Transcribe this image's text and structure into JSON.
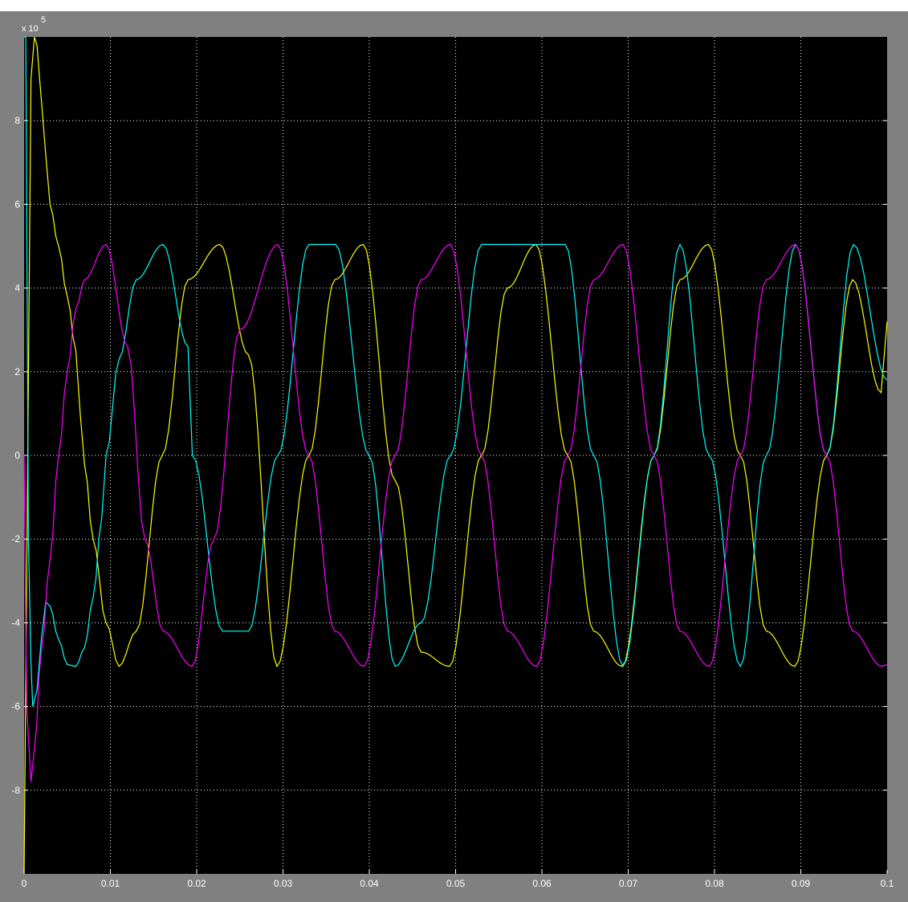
{
  "window": {
    "frame_color": "#808080",
    "plot_background": "#000000",
    "grid_color": "#ffffff",
    "axis_text_color": "#ffffff"
  },
  "chart_data": {
    "type": "line",
    "title": "",
    "xlabel": "",
    "ylabel": "",
    "x_range": [
      0,
      0.1
    ],
    "y_range": [
      -1000000,
      1000000
    ],
    "y_exponent_label": {
      "base": "x 10",
      "exponent": "5"
    },
    "x_ticks": [
      "0",
      "0.01",
      "0.02",
      "0.03",
      "0.04",
      "0.05",
      "0.06",
      "0.07",
      "0.08",
      "0.09",
      "0.1"
    ],
    "x_tick_values": [
      0,
      0.01,
      0.02,
      0.03,
      0.04,
      0.05,
      0.06,
      0.07,
      0.08,
      0.09,
      0.1
    ],
    "y_ticks": [
      "-8",
      "-6",
      "-4",
      "-2",
      "0",
      "2",
      "4",
      "6",
      "8"
    ],
    "y_tick_values": [
      -800000,
      -600000,
      -400000,
      -200000,
      0,
      200000,
      400000,
      600000,
      800000
    ],
    "grid": true,
    "legend": "none",
    "steady_state": {
      "amplitude": 504000,
      "frequency_hz": 50
    },
    "series": [
      {
        "color": "#ffff00",
        "x": [
          0,
          0.0003,
          0.0008,
          0.0012,
          0.0015,
          0.0018,
          0.002,
          0.0025,
          0.003,
          0.004,
          0.005,
          0.006,
          0.0065,
          0.007,
          0.008,
          0.0095,
          0.011,
          0.013,
          0.016,
          0.019,
          0.0227,
          0.026,
          0.0293,
          0.033,
          0.036,
          0.0393,
          0.043,
          0.046,
          0.0493,
          0.053,
          0.056,
          0.0593,
          0.063,
          0.066,
          0.0693,
          0.073,
          0.076,
          0.0793,
          0.083,
          0.086,
          0.0893,
          0.093,
          0.096,
          0.0993,
          0.1
        ],
        "y": [
          -1000000,
          -300000,
          900000,
          1000000,
          980000,
          900000,
          850000,
          720000,
          600000,
          500000,
          380000,
          250000,
          100000,
          -20000,
          -200000,
          -400000,
          -504000,
          -420000,
          0,
          420000,
          504000,
          240000,
          -504000,
          0,
          420000,
          504000,
          -60000,
          -470000,
          -504000,
          0,
          400000,
          504000,
          0,
          -420000,
          -504000,
          0,
          420000,
          504000,
          0,
          -420000,
          -504000,
          0,
          420000,
          150000,
          320000
        ]
      },
      {
        "color": "#00ffff",
        "x": [
          0,
          0.0002,
          0.0005,
          0.0008,
          0.001,
          0.0015,
          0.002,
          0.0025,
          0.003,
          0.004,
          0.005,
          0.006,
          0.007,
          0.008,
          0.009,
          0.0095,
          0.011,
          0.013,
          0.0161,
          0.019,
          0.0195,
          0.023,
          0.026,
          0.0294,
          0.033,
          0.036,
          0.0361,
          0.04,
          0.043,
          0.046,
          0.0494,
          0.053,
          0.056,
          0.0627,
          0.066,
          0.0694,
          0.073,
          0.076,
          0.0794,
          0.083,
          0.086,
          0.0894,
          0.093,
          0.0961,
          0.1
        ],
        "y": [
          1000000,
          1000000,
          -200000,
          -500000,
          -600000,
          -560000,
          -440000,
          -350000,
          -360000,
          -440000,
          -500000,
          -504000,
          -460000,
          -340000,
          -150000,
          0,
          230000,
          420000,
          504000,
          260000,
          0,
          -420000,
          -420000,
          0,
          504000,
          504000,
          504000,
          0,
          -504000,
          -400000,
          0,
          504000,
          504000,
          504000,
          0,
          -504000,
          0,
          504000,
          0,
          -504000,
          0,
          504000,
          0,
          504000,
          180000
        ]
      },
      {
        "color": "#ff00ff",
        "x": [
          0,
          0.0003,
          0.0008,
          0.0012,
          0.002,
          0.003,
          0.004,
          0.005,
          0.006,
          0.007,
          0.0095,
          0.012,
          0.014,
          0.0161,
          0.0195,
          0.022,
          0.025,
          0.0294,
          0.033,
          0.036,
          0.0394,
          0.043,
          0.046,
          0.0494,
          0.053,
          0.056,
          0.0594,
          0.063,
          0.066,
          0.0694,
          0.073,
          0.076,
          0.0794,
          0.083,
          0.086,
          0.0894,
          0.093,
          0.096,
          0.0994,
          0.1
        ],
        "y": [
          0,
          -600000,
          -780000,
          -700000,
          -470000,
          -250000,
          0,
          200000,
          350000,
          420000,
          504000,
          260000,
          -200000,
          -420000,
          -504000,
          -200000,
          300000,
          504000,
          0,
          -420000,
          -504000,
          0,
          420000,
          504000,
          0,
          -420000,
          -504000,
          0,
          420000,
          504000,
          0,
          -420000,
          -504000,
          0,
          420000,
          504000,
          0,
          -420000,
          -504000,
          -500000
        ]
      }
    ]
  }
}
